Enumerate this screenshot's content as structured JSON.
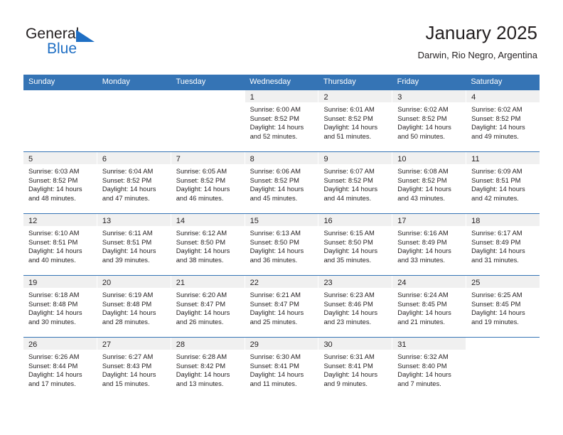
{
  "brand": {
    "name_top": "General",
    "name_bottom": "Blue",
    "triangle_color": "#1f6fc4"
  },
  "header": {
    "title": "January 2025",
    "subtitle": "Darwin, Rio Negro, Argentina"
  },
  "theme": {
    "header_blue": "#3574b5",
    "day_band_grey": "#f0f0f0",
    "text": "#231f20"
  },
  "weekdays": [
    "Sunday",
    "Monday",
    "Tuesday",
    "Wednesday",
    "Thursday",
    "Friday",
    "Saturday"
  ],
  "labels": {
    "sunrise_prefix": "Sunrise:",
    "sunset_prefix": "Sunset:",
    "daylight_prefix": "Daylight:"
  },
  "weeks": [
    [
      {
        "day": "",
        "blank": true
      },
      {
        "day": "",
        "blank": true
      },
      {
        "day": "",
        "blank": true
      },
      {
        "day": "1",
        "sunrise": "Sunrise: 6:00 AM",
        "sunset": "Sunset: 8:52 PM",
        "daylight1": "Daylight: 14 hours",
        "daylight2": "and 52 minutes."
      },
      {
        "day": "2",
        "sunrise": "Sunrise: 6:01 AM",
        "sunset": "Sunset: 8:52 PM",
        "daylight1": "Daylight: 14 hours",
        "daylight2": "and 51 minutes."
      },
      {
        "day": "3",
        "sunrise": "Sunrise: 6:02 AM",
        "sunset": "Sunset: 8:52 PM",
        "daylight1": "Daylight: 14 hours",
        "daylight2": "and 50 minutes."
      },
      {
        "day": "4",
        "sunrise": "Sunrise: 6:02 AM",
        "sunset": "Sunset: 8:52 PM",
        "daylight1": "Daylight: 14 hours",
        "daylight2": "and 49 minutes."
      }
    ],
    [
      {
        "day": "5",
        "sunrise": "Sunrise: 6:03 AM",
        "sunset": "Sunset: 8:52 PM",
        "daylight1": "Daylight: 14 hours",
        "daylight2": "and 48 minutes."
      },
      {
        "day": "6",
        "sunrise": "Sunrise: 6:04 AM",
        "sunset": "Sunset: 8:52 PM",
        "daylight1": "Daylight: 14 hours",
        "daylight2": "and 47 minutes."
      },
      {
        "day": "7",
        "sunrise": "Sunrise: 6:05 AM",
        "sunset": "Sunset: 8:52 PM",
        "daylight1": "Daylight: 14 hours",
        "daylight2": "and 46 minutes."
      },
      {
        "day": "8",
        "sunrise": "Sunrise: 6:06 AM",
        "sunset": "Sunset: 8:52 PM",
        "daylight1": "Daylight: 14 hours",
        "daylight2": "and 45 minutes."
      },
      {
        "day": "9",
        "sunrise": "Sunrise: 6:07 AM",
        "sunset": "Sunset: 8:52 PM",
        "daylight1": "Daylight: 14 hours",
        "daylight2": "and 44 minutes."
      },
      {
        "day": "10",
        "sunrise": "Sunrise: 6:08 AM",
        "sunset": "Sunset: 8:52 PM",
        "daylight1": "Daylight: 14 hours",
        "daylight2": "and 43 minutes."
      },
      {
        "day": "11",
        "sunrise": "Sunrise: 6:09 AM",
        "sunset": "Sunset: 8:51 PM",
        "daylight1": "Daylight: 14 hours",
        "daylight2": "and 42 minutes."
      }
    ],
    [
      {
        "day": "12",
        "sunrise": "Sunrise: 6:10 AM",
        "sunset": "Sunset: 8:51 PM",
        "daylight1": "Daylight: 14 hours",
        "daylight2": "and 40 minutes."
      },
      {
        "day": "13",
        "sunrise": "Sunrise: 6:11 AM",
        "sunset": "Sunset: 8:51 PM",
        "daylight1": "Daylight: 14 hours",
        "daylight2": "and 39 minutes."
      },
      {
        "day": "14",
        "sunrise": "Sunrise: 6:12 AM",
        "sunset": "Sunset: 8:50 PM",
        "daylight1": "Daylight: 14 hours",
        "daylight2": "and 38 minutes."
      },
      {
        "day": "15",
        "sunrise": "Sunrise: 6:13 AM",
        "sunset": "Sunset: 8:50 PM",
        "daylight1": "Daylight: 14 hours",
        "daylight2": "and 36 minutes."
      },
      {
        "day": "16",
        "sunrise": "Sunrise: 6:15 AM",
        "sunset": "Sunset: 8:50 PM",
        "daylight1": "Daylight: 14 hours",
        "daylight2": "and 35 minutes."
      },
      {
        "day": "17",
        "sunrise": "Sunrise: 6:16 AM",
        "sunset": "Sunset: 8:49 PM",
        "daylight1": "Daylight: 14 hours",
        "daylight2": "and 33 minutes."
      },
      {
        "day": "18",
        "sunrise": "Sunrise: 6:17 AM",
        "sunset": "Sunset: 8:49 PM",
        "daylight1": "Daylight: 14 hours",
        "daylight2": "and 31 minutes."
      }
    ],
    [
      {
        "day": "19",
        "sunrise": "Sunrise: 6:18 AM",
        "sunset": "Sunset: 8:48 PM",
        "daylight1": "Daylight: 14 hours",
        "daylight2": "and 30 minutes."
      },
      {
        "day": "20",
        "sunrise": "Sunrise: 6:19 AM",
        "sunset": "Sunset: 8:48 PM",
        "daylight1": "Daylight: 14 hours",
        "daylight2": "and 28 minutes."
      },
      {
        "day": "21",
        "sunrise": "Sunrise: 6:20 AM",
        "sunset": "Sunset: 8:47 PM",
        "daylight1": "Daylight: 14 hours",
        "daylight2": "and 26 minutes."
      },
      {
        "day": "22",
        "sunrise": "Sunrise: 6:21 AM",
        "sunset": "Sunset: 8:47 PM",
        "daylight1": "Daylight: 14 hours",
        "daylight2": "and 25 minutes."
      },
      {
        "day": "23",
        "sunrise": "Sunrise: 6:23 AM",
        "sunset": "Sunset: 8:46 PM",
        "daylight1": "Daylight: 14 hours",
        "daylight2": "and 23 minutes."
      },
      {
        "day": "24",
        "sunrise": "Sunrise: 6:24 AM",
        "sunset": "Sunset: 8:45 PM",
        "daylight1": "Daylight: 14 hours",
        "daylight2": "and 21 minutes."
      },
      {
        "day": "25",
        "sunrise": "Sunrise: 6:25 AM",
        "sunset": "Sunset: 8:45 PM",
        "daylight1": "Daylight: 14 hours",
        "daylight2": "and 19 minutes."
      }
    ],
    [
      {
        "day": "26",
        "sunrise": "Sunrise: 6:26 AM",
        "sunset": "Sunset: 8:44 PM",
        "daylight1": "Daylight: 14 hours",
        "daylight2": "and 17 minutes."
      },
      {
        "day": "27",
        "sunrise": "Sunrise: 6:27 AM",
        "sunset": "Sunset: 8:43 PM",
        "daylight1": "Daylight: 14 hours",
        "daylight2": "and 15 minutes."
      },
      {
        "day": "28",
        "sunrise": "Sunrise: 6:28 AM",
        "sunset": "Sunset: 8:42 PM",
        "daylight1": "Daylight: 14 hours",
        "daylight2": "and 13 minutes."
      },
      {
        "day": "29",
        "sunrise": "Sunrise: 6:30 AM",
        "sunset": "Sunset: 8:41 PM",
        "daylight1": "Daylight: 14 hours",
        "daylight2": "and 11 minutes."
      },
      {
        "day": "30",
        "sunrise": "Sunrise: 6:31 AM",
        "sunset": "Sunset: 8:41 PM",
        "daylight1": "Daylight: 14 hours",
        "daylight2": "and 9 minutes."
      },
      {
        "day": "31",
        "sunrise": "Sunrise: 6:32 AM",
        "sunset": "Sunset: 8:40 PM",
        "daylight1": "Daylight: 14 hours",
        "daylight2": "and 7 minutes."
      },
      {
        "day": "",
        "blank": true
      }
    ]
  ]
}
